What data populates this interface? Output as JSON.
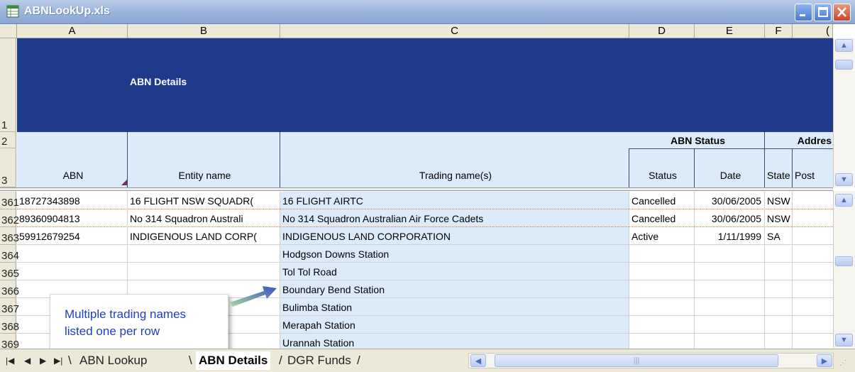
{
  "window": {
    "title": "ABNLookUp.xls"
  },
  "columns": [
    "A",
    "B",
    "C",
    "D",
    "E",
    "F",
    "("
  ],
  "banner": {
    "title": "ABN Details"
  },
  "group_headers": {
    "abn_status": "ABN Status",
    "address": "Addres"
  },
  "column_labels": {
    "abn": "ABN",
    "entity_name": "Entity name",
    "trading_names": "Trading name(s)",
    "status": "Status",
    "date": "Date",
    "state": "State",
    "postcode": "Post"
  },
  "header_row_numbers": [
    "1",
    "2",
    "3"
  ],
  "rows": [
    {
      "num": "361",
      "abn": "18727343898",
      "entity": "16 FLIGHT NSW SQUADR(",
      "trading": "16 FLIGHT AIRTC",
      "status": "Cancelled",
      "date": "30/06/2005",
      "state": "NSW"
    },
    {
      "num": "362",
      "abn": "89360904813",
      "entity": "No 314 Squadron Australi",
      "trading": "No 314 Squadron Australian Air Force Cadets",
      "status": "Cancelled",
      "date": "30/06/2005",
      "state": "NSW"
    },
    {
      "num": "363",
      "abn": "59912679254",
      "entity": "INDIGENOUS LAND CORP(",
      "trading": "INDIGENOUS LAND CORPORATION",
      "status": "Active",
      "date": "1/11/1999",
      "state": "SA"
    },
    {
      "num": "364",
      "abn": "",
      "entity": "",
      "trading": "Hodgson Downs Station",
      "status": "",
      "date": "",
      "state": ""
    },
    {
      "num": "365",
      "abn": "",
      "entity": "",
      "trading": "Tol Tol Road",
      "status": "",
      "date": "",
      "state": ""
    },
    {
      "num": "366",
      "abn": "",
      "entity": "",
      "trading": "Boundary Bend Station",
      "status": "",
      "date": "",
      "state": ""
    },
    {
      "num": "367",
      "abn": "",
      "entity": "",
      "trading": "Bulimba Station",
      "status": "",
      "date": "",
      "state": ""
    },
    {
      "num": "368",
      "abn": "",
      "entity": "",
      "trading": "Merapah Station",
      "status": "",
      "date": "",
      "state": ""
    },
    {
      "num": "369",
      "abn": "",
      "entity": "",
      "trading": "Urannah Station",
      "status": "",
      "date": "",
      "state": ""
    }
  ],
  "callout": {
    "line1": "Multiple trading names",
    "line2": "listed one per row"
  },
  "sheet_tabs": [
    {
      "label": "ABN Lookup",
      "active": false
    },
    {
      "label": "ABN Details",
      "active": true
    },
    {
      "label": "DGR Funds",
      "active": false
    }
  ],
  "nav_buttons": [
    "first",
    "prev",
    "next",
    "last"
  ],
  "colors": {
    "banner": "#1e3a8a",
    "header_fill": "#dcebfa",
    "callout_text": "#1f3ec3",
    "title_bar": "#9eb7dd"
  }
}
